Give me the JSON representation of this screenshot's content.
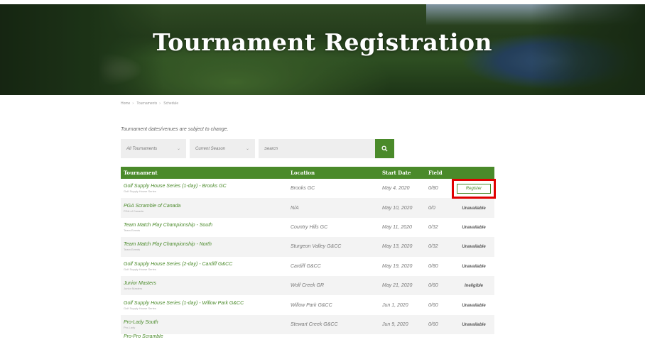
{
  "hero": {
    "title": "Tournament Registration"
  },
  "breadcrumb": [
    "Home",
    "Tournaments",
    "Schedule"
  ],
  "notice": "Tournament dates/venues are subject to change.",
  "filters": {
    "tournament_select": "All Tournaments",
    "season_select": "Current Season",
    "search_placeholder": "Search",
    "search_icon": "search-icon"
  },
  "table": {
    "headers": {
      "tournament": "Tournament",
      "location": "Location",
      "start_date": "Start Date",
      "field": "Field",
      "action": ""
    },
    "rows": [
      {
        "name": "Golf Supply House Series (1-day) - Brooks GC",
        "series": "Golf Supply House Series",
        "location": "Brooks GC",
        "date": "May 4, 2020",
        "field": "0/80",
        "action": "Register"
      },
      {
        "name": "PGA Scramble of Canada",
        "series": "PGA of Canada",
        "location": "N/A",
        "date": "May 10, 2020",
        "field": "0/0",
        "action": "Unavailable"
      },
      {
        "name": "Team Match Play Championship - South",
        "series": "Team Events",
        "location": "Country Hills GC",
        "date": "May 11, 2020",
        "field": "0/32",
        "action": "Unavailable"
      },
      {
        "name": "Team Match Play Championship - North",
        "series": "Team Events",
        "location": "Sturgeon Valley G&CC",
        "date": "May 13, 2020",
        "field": "0/32",
        "action": "Unavailable"
      },
      {
        "name": "Golf Supply House Series (2-day) - Cardiff G&CC",
        "series": "Golf Supply House Series",
        "location": "Cardiff G&CC",
        "date": "May 19, 2020",
        "field": "0/80",
        "action": "Unavailable"
      },
      {
        "name": "Junior Masters",
        "series": "Junior Masters",
        "location": "Wolf Creek GR",
        "date": "May 21, 2020",
        "field": "0/60",
        "action": "Ineligible"
      },
      {
        "name": "Golf Supply House Series (1-day) - Willow Park G&CC",
        "series": "Golf Supply House Series",
        "location": "Willow Park G&CC",
        "date": "Jun 1, 2020",
        "field": "0/60",
        "action": "Unavailable"
      },
      {
        "name": "Pro-Lady South",
        "series": "Pro-Lady",
        "location": "Stewart Creek G&CC",
        "date": "Jun 9, 2020",
        "field": "0/60",
        "action": "Unavailable"
      },
      {
        "name": "Pro-Pro Scramble",
        "series": "",
        "location": "",
        "date": "",
        "field": "",
        "action": ""
      }
    ]
  },
  "colors": {
    "accent": "#4a8a2a",
    "highlight": "#e00000"
  }
}
